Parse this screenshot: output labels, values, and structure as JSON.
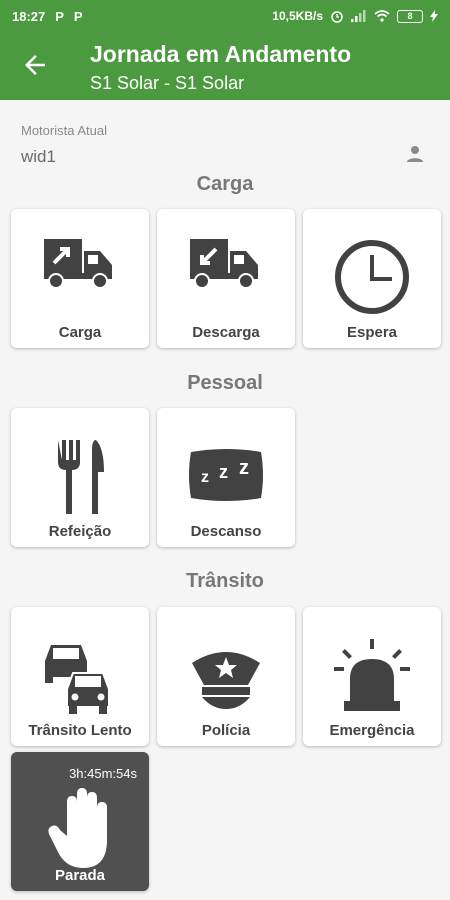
{
  "status_bar": {
    "time": "18:27",
    "notif1": "P",
    "notif2": "P",
    "net_speed": "10,5KB/s",
    "battery": "8"
  },
  "header": {
    "title": "Jornada em Andamento",
    "subtitle": "S1 Solar - S1 Solar"
  },
  "driver": {
    "label": "Motorista Atual",
    "name": "wid1"
  },
  "sections": {
    "carga": "Carga",
    "pessoal": "Pessoal",
    "transito": "Trânsito"
  },
  "cards": {
    "carga": "Carga",
    "descarga": "Descarga",
    "espera": "Espera",
    "refeicao": "Refeição",
    "descanso": "Descanso",
    "transito_lento": "Trânsito Lento",
    "policia": "Polícia",
    "emergencia": "Emergência",
    "parada": "Parada"
  },
  "parada_timer": "3h:45m:54s",
  "colors": {
    "header": "#4c9a3f",
    "icon": "#424242",
    "active_card": "#505050"
  }
}
